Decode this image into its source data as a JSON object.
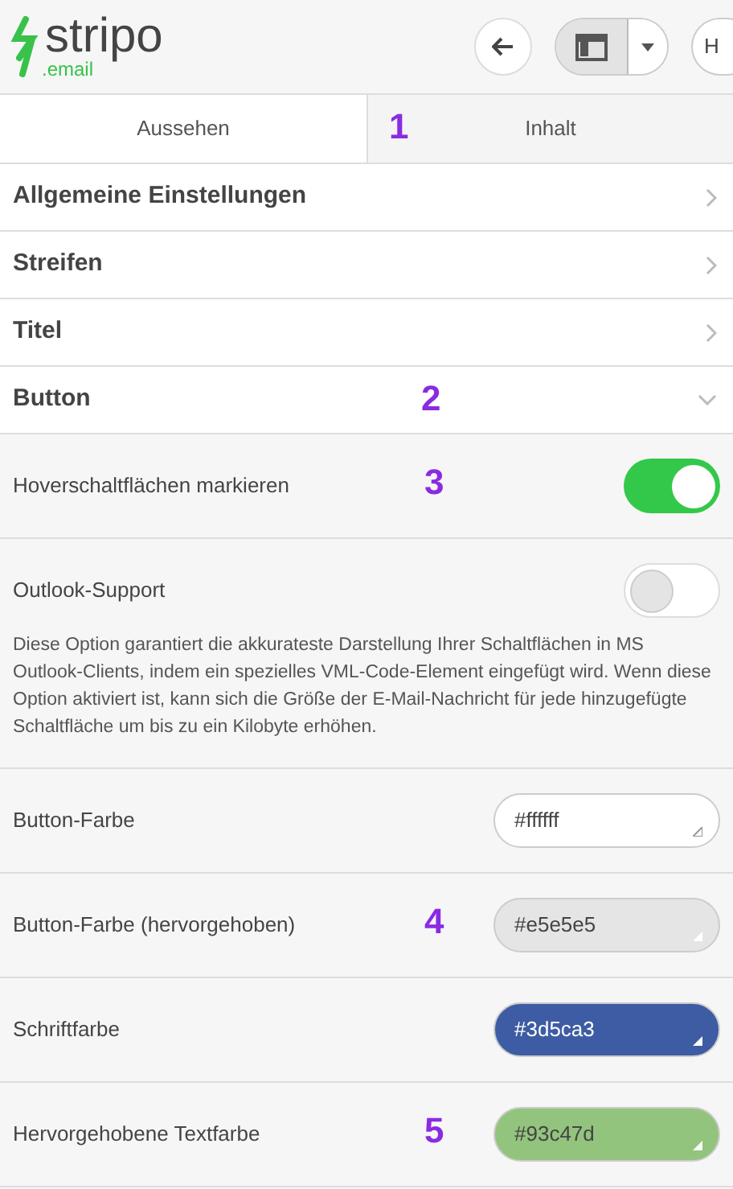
{
  "header": {
    "logo": {
      "name": "stripo",
      "suffix": ".email"
    },
    "cut_button": "H"
  },
  "tabs": [
    {
      "label": "Aussehen",
      "selected": true
    },
    {
      "label": "Inhalt",
      "selected": false,
      "annotation": "1"
    }
  ],
  "sections": [
    {
      "title": "Allgemeine Einstellungen",
      "expanded": false
    },
    {
      "title": "Streifen",
      "expanded": false
    },
    {
      "title": "Titel",
      "expanded": false
    },
    {
      "title": "Button",
      "expanded": true,
      "annotation": "2"
    }
  ],
  "settings": [
    {
      "kind": "toggle",
      "label": "Hoverschaltflächen markieren",
      "on": true,
      "annotation": "3"
    },
    {
      "kind": "toggle",
      "label": "Outlook-Support",
      "on": false,
      "description": "Diese Option garantiert die akkurateste Darstellung Ihrer Schaltflächen in MS Outlook-Clients, indem ein spezielles VML-Code-Element eingefügt wird. Wenn diese Option aktiviert ist, kann sich die Größe der E-Mail-Nachricht für jede hinzugefügte Schaltfläche um bis zu ein Kilobyte erhöhen."
    },
    {
      "kind": "color",
      "label": "Button-Farbe",
      "value": "#ffffff",
      "color": "#ffffff"
    },
    {
      "kind": "color",
      "label": "Button-Farbe (hervorgehoben)",
      "value": "#e5e5e5",
      "color": "#e5e5e5",
      "annotation": "4"
    },
    {
      "kind": "color",
      "label": "Schriftfarbe",
      "value": "#3d5ca3",
      "color": "#3d5ca3"
    },
    {
      "kind": "color",
      "label": "Hervorgehobene Textfarbe",
      "value": "#93c47d",
      "color": "#93c47d",
      "annotation": "5"
    }
  ]
}
